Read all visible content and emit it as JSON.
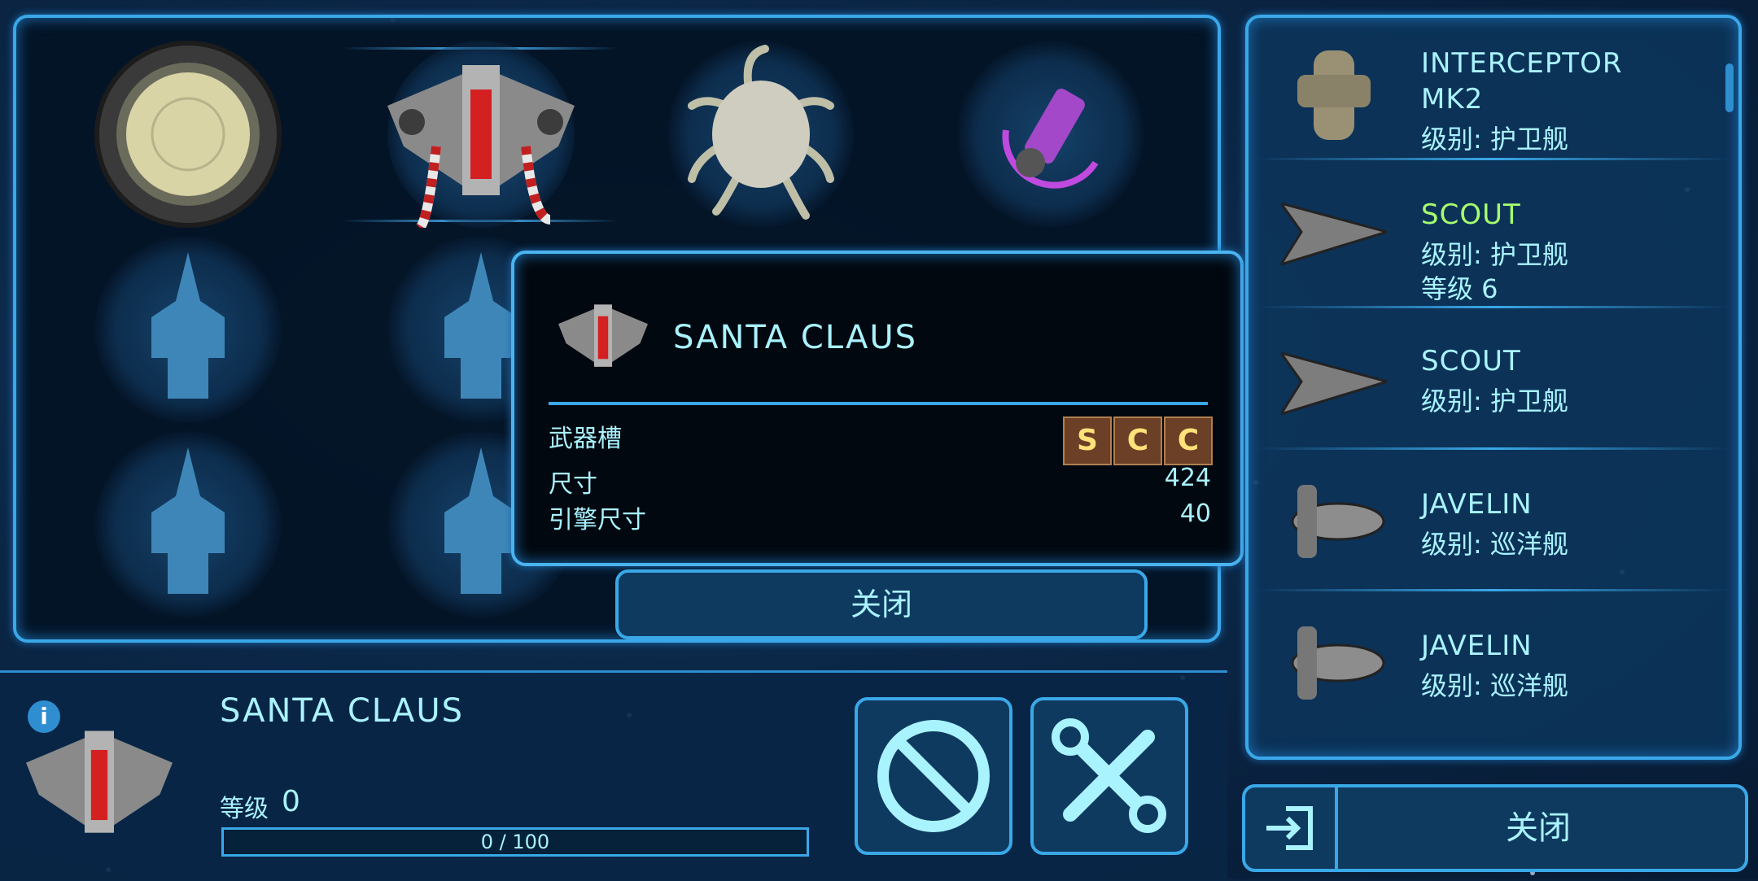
{
  "popup": {
    "ship_name": "SANTA CLAUS",
    "weapon_slots_label": "武器槽",
    "weapon_slots": [
      "S",
      "C",
      "C"
    ],
    "size_label": "尺寸",
    "size_value": "424",
    "engine_size_label": "引擎尺寸",
    "engine_size_value": "40",
    "close_label": "关闭"
  },
  "ship_grid": {
    "items": [
      {
        "icon": "ring-station-icon"
      },
      {
        "icon": "santa-claus-ship-icon",
        "selected": true
      },
      {
        "icon": "tentacle-creature-icon"
      },
      {
        "icon": "purple-turret-icon"
      },
      {
        "icon": "empty-ship-slot-icon"
      },
      {
        "icon": "empty-ship-slot-icon"
      },
      {
        "icon": "empty-ship-slot-icon"
      },
      {
        "icon": "empty-ship-slot-icon"
      }
    ]
  },
  "fleet_list": {
    "items": [
      {
        "name": "INTERCEPTOR",
        "name2": "MK2",
        "class": "级别: 护卫舰"
      },
      {
        "name": "SCOUT",
        "class": "级别: 护卫舰",
        "level": "等级 6",
        "highlight": true
      },
      {
        "name": "SCOUT",
        "class": "级别: 护卫舰"
      },
      {
        "name": "JAVELIN",
        "class": "级别: 巡洋舰"
      },
      {
        "name": "JAVELIN",
        "class": "级别: 巡洋舰"
      }
    ]
  },
  "bottom": {
    "ship_name": "SANTA CLAUS",
    "level_label": "等级",
    "level_value": "0",
    "xp_text": "0 / 100",
    "xp_fraction": 0
  },
  "exit": {
    "label": "关闭"
  },
  "colors": {
    "accent": "#3aa8e8",
    "text": "#a9f3ff",
    "highlight": "#a6ff6e",
    "slot_bg": "#6b4026",
    "slot_text": "#ffe27a"
  }
}
